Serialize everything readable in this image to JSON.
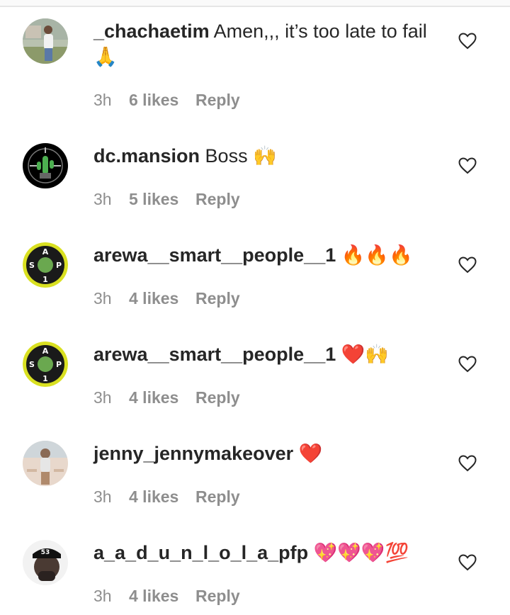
{
  "comments": [
    {
      "username": "_chachaetim",
      "text": "Amen,,, it’s too late to fail",
      "emoji_line": "🙏",
      "time": "3h",
      "likes": "6 likes",
      "reply": "Reply",
      "avatar_icon": "profile-photo-person"
    },
    {
      "username": "dc.mansion",
      "text": "Boss 🙌",
      "time": "3h",
      "likes": "5 likes",
      "reply": "Reply",
      "avatar_icon": "cactus-logo"
    },
    {
      "username": "arewa__smart__people__1",
      "text": "🔥🔥🔥",
      "time": "3h",
      "likes": "4 likes",
      "reply": "Reply",
      "avatar_icon": "asp-logo"
    },
    {
      "username": "arewa__smart__people__1",
      "text": "❤️🙌",
      "time": "3h",
      "likes": "4 likes",
      "reply": "Reply",
      "avatar_icon": "asp-logo"
    },
    {
      "username": "jenny_jennymakeover",
      "text": "❤️",
      "time": "3h",
      "likes": "4 likes",
      "reply": "Reply",
      "avatar_icon": "profile-photo-person"
    },
    {
      "username": "a_a_d_u_n_l_o_l_a_pfp",
      "text": "💖💖💖💯",
      "time": "3h",
      "likes": "4 likes",
      "reply": "Reply",
      "avatar_icon": "profile-photo-person-cap"
    }
  ],
  "avatar_text": {
    "asp_top": "A",
    "asp_left": "S",
    "asp_right": "P",
    "asp_bottom": "1",
    "cap_text": "53"
  },
  "colors": {
    "text": "#262626",
    "secondary": "#8e8e8e",
    "asp_ring": "#d9e021"
  }
}
